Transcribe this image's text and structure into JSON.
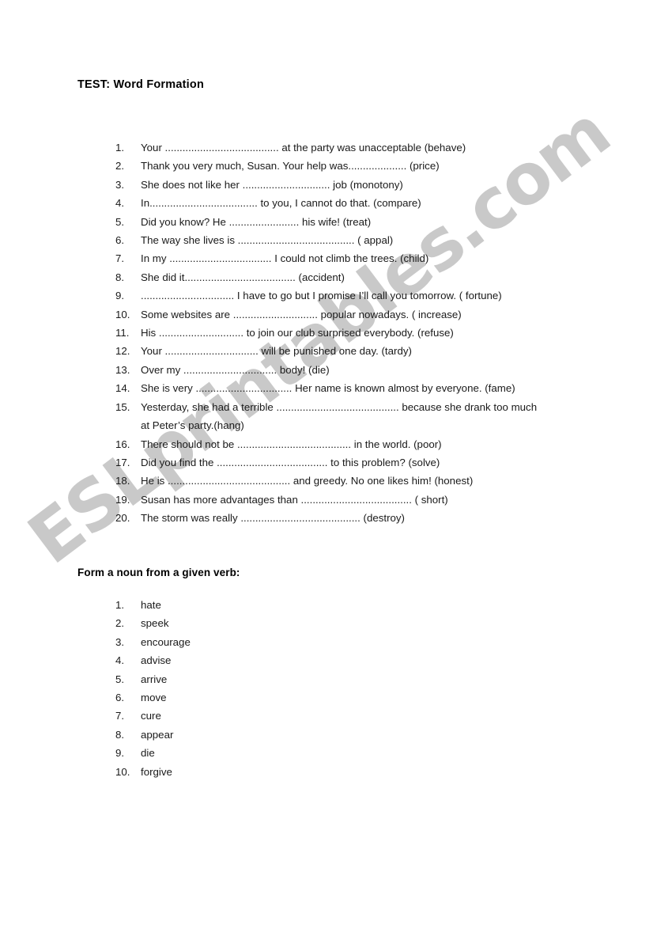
{
  "document": {
    "title": "TEST:  Word Formation",
    "section_heading": "Form a noun from a given verb:",
    "watermark": "ESLprintables.com",
    "watermark_color": "#c9c9c9",
    "text_color": "#1a1a1a",
    "background_color": "#ffffff"
  },
  "sentences": [
    {
      "number": "1.",
      "text": "Your ....................................... at the party was unacceptable (behave)"
    },
    {
      "number": "2.",
      "text": "Thank you very much, Susan. Your help was.................... (price)"
    },
    {
      "number": "3.",
      "text": "She does not like her .............................. job (monotony)"
    },
    {
      "number": "4.",
      "text": "In..................................... to you, I cannot do that. (compare)"
    },
    {
      "number": "5.",
      "text": "Did you know? He ........................ his wife! (treat)"
    },
    {
      "number": "6.",
      "text": "The way she lives is ........................................ ( appal)"
    },
    {
      "number": "7.",
      "text": "In my ................................... I could not climb the trees. (child)"
    },
    {
      "number": "8.",
      "text": "She did it...................................... (accident)"
    },
    {
      "number": "9.",
      "text": "................................ I have to go but I promise I’ll call you tomorrow.  ( fortune)"
    },
    {
      "number": "10.",
      "text": "Some websites are ............................. popular nowadays. ( increase)"
    },
    {
      "number": "11.",
      "text": "His ............................. to join our club surprised everybody. (refuse)"
    },
    {
      "number": "12.",
      "text": "Your ................................ will be punished one day. (tardy)"
    },
    {
      "number": "13.",
      "text": "Over my ................................ body!  (die)"
    },
    {
      "number": "14.",
      "text": "She is very .................................  Her name is known almost by everyone. (fame)"
    },
    {
      "number": "15.",
      "text": "Yesterday, she had a terrible ..........................................  because she drank  too much",
      "continuation": "at Peter’s party.(hang)"
    },
    {
      "number": "16.",
      "text": "There should not be ....................................... in the world. (poor)"
    },
    {
      "number": "17.",
      "text": "Did you find the ...................................... to this problem? (solve)"
    },
    {
      "number": "18.",
      "text": "He is .......................................... and greedy. No one likes him! (honest)"
    },
    {
      "number": "19.",
      "text": "Susan has more advantages than ...................................... ( short)"
    },
    {
      "number": "20.",
      "text": "The storm was really ......................................... (destroy)"
    }
  ],
  "verbs": [
    {
      "number": "1.",
      "text": "hate"
    },
    {
      "number": "2.",
      "text": "speek"
    },
    {
      "number": "3.",
      "text": "encourage"
    },
    {
      "number": "4.",
      "text": "advise"
    },
    {
      "number": "5.",
      "text": "arrive"
    },
    {
      "number": "6.",
      "text": "move"
    },
    {
      "number": "7.",
      "text": "cure"
    },
    {
      "number": "8.",
      "text": "appear"
    },
    {
      "number": "9.",
      "text": "die"
    },
    {
      "number": "10.",
      "text": "forgive"
    }
  ]
}
